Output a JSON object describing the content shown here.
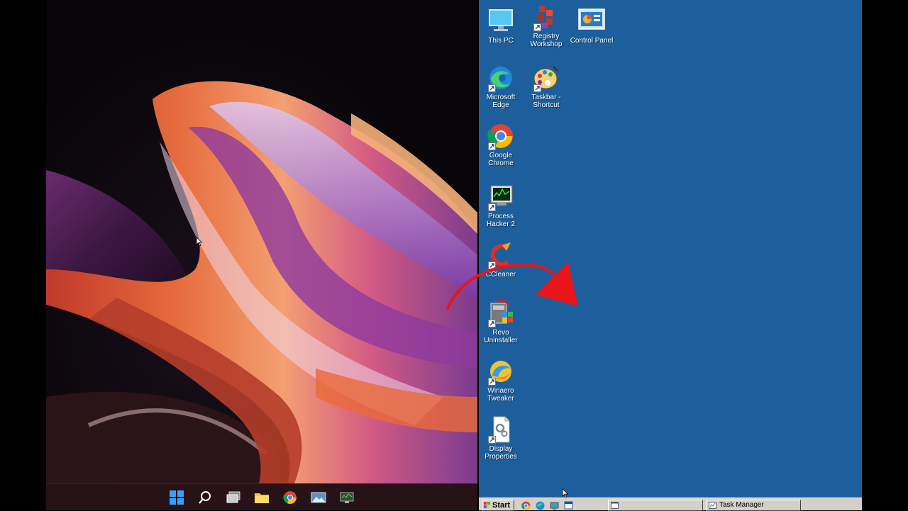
{
  "left_desktop": {
    "taskbar_icons": [
      "windows-start-icon",
      "search-icon",
      "task-view-icon",
      "file-explorer-icon",
      "chrome-icon",
      "photos-icon",
      "monitor-icon"
    ]
  },
  "right_desktop": {
    "icons": [
      {
        "label": "This PC",
        "icon": "this-pc-icon"
      },
      {
        "label": "Registry Workshop",
        "icon": "registry-workshop-icon"
      },
      {
        "label": "Control Panel",
        "icon": "control-panel-icon"
      },
      {
        "label": "Microsoft Edge",
        "icon": "edge-icon"
      },
      {
        "label": "Taskbar - Shortcut",
        "icon": "paint-palette-icon"
      },
      {
        "label": "Google Chrome",
        "icon": "chrome-icon"
      },
      {
        "label": "Process Hacker 2",
        "icon": "process-hacker-icon"
      },
      {
        "label": "CCleaner",
        "icon": "ccleaner-icon"
      },
      {
        "label": "Revo Uninstaller",
        "icon": "revo-uninstaller-icon"
      },
      {
        "label": "Winaero Tweaker",
        "icon": "winaero-tweaker-icon"
      },
      {
        "label": "Display Properties",
        "icon": "display-properties-icon"
      }
    ],
    "taskbar": {
      "start_label": "Start",
      "quick_launch": [
        "chrome-icon",
        "edge-icon",
        "desktop-icon",
        "window-icon"
      ],
      "tasks": [
        {
          "label": ""
        },
        {
          "label": "Task Manager"
        }
      ]
    }
  },
  "colors": {
    "classic_desktop": "#1c5f9c",
    "annotation_arrow": "#e8161a",
    "classic_taskbar": "#d4d0c8"
  }
}
